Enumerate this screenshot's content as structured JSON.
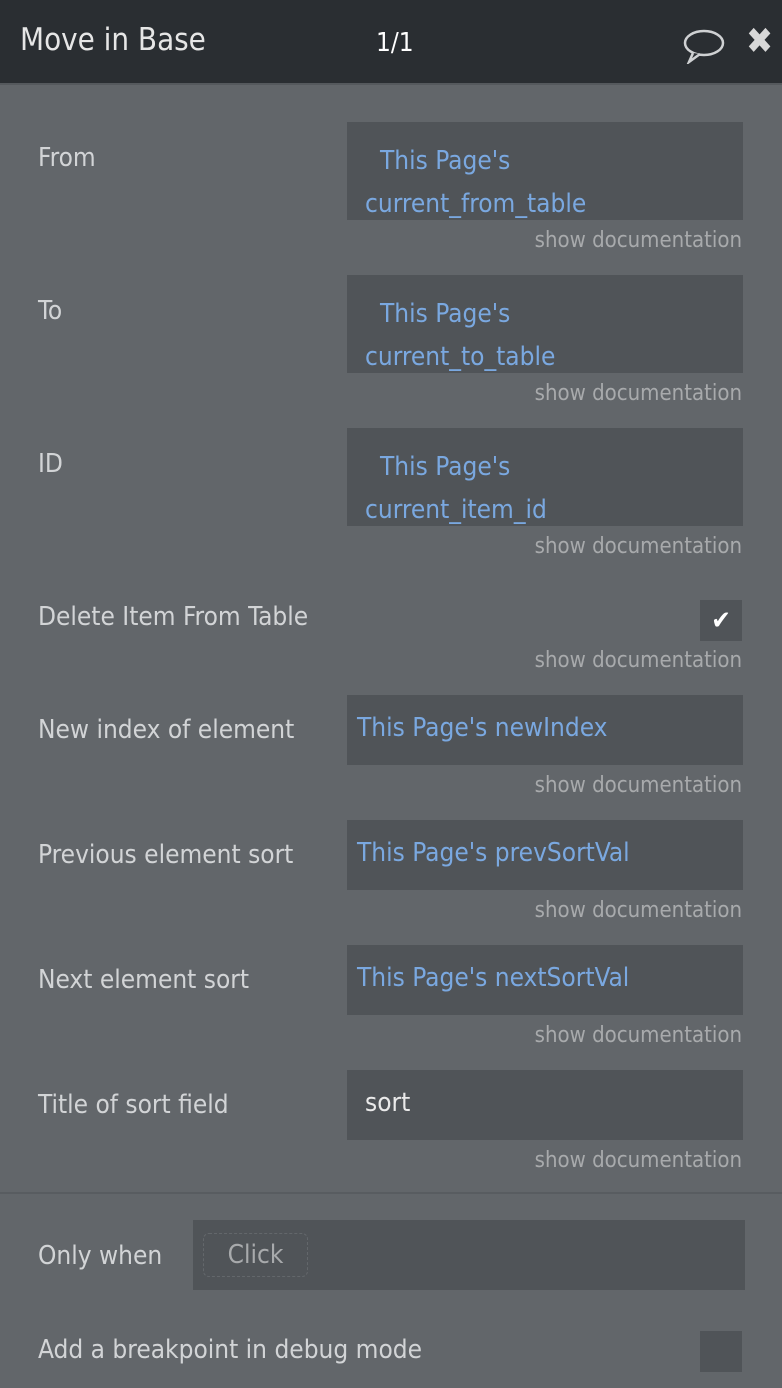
{
  "header": {
    "title": "Move in Base",
    "page": "1/1"
  },
  "fields": [
    {
      "label": "From",
      "line1": "This Page's",
      "line2": "current_from_table"
    },
    {
      "label": "To",
      "line1": "This Page's",
      "line2": "current_to_table"
    },
    {
      "label": "ID",
      "line1": "This Page's",
      "line2": "current_item_id"
    }
  ],
  "delete": {
    "label": "Delete Item From Table",
    "checked": true
  },
  "short_fields": [
    {
      "label": "New index of element",
      "value": "This Page's newIndex"
    },
    {
      "label": "Previous element sort",
      "value": "This Page's prevSortVal"
    },
    {
      "label": "Next element sort",
      "value": "This Page's nextSortVal"
    },
    {
      "label": "Title of sort field",
      "value": "sort"
    }
  ],
  "doc_link": "show documentation",
  "only_when": {
    "label": "Only when",
    "placeholder": "Click"
  },
  "breakpoint": {
    "label": "Add a breakpoint in debug mode",
    "checked": false
  }
}
